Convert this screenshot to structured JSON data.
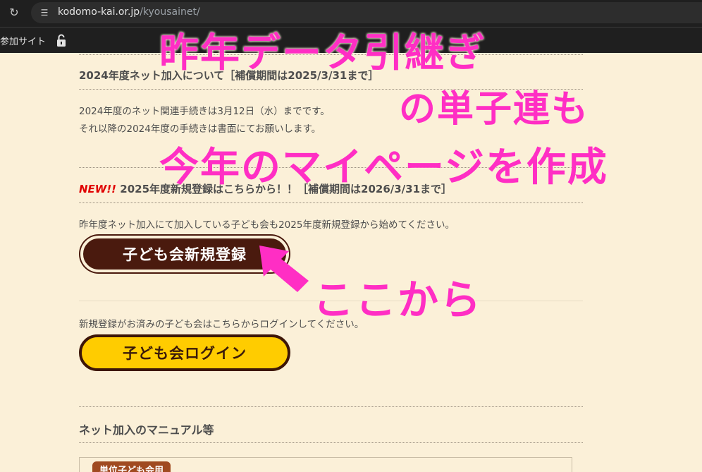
{
  "browser": {
    "url_host": "kodomo-kai.or.jp",
    "url_path": "/kyousainet/",
    "bookmark_label": "参加サイト"
  },
  "page": {
    "section1_heading": "2024年度ネット加入について［補償期間は2025/3/31まで］",
    "section1_line1": "2024年度のネット関連手続きは3月12日（水）までです。",
    "section1_line2": "それ以降の2024年度の手続きは書面にてお願いします。",
    "section2_new": "NEW!!",
    "section2_heading": " 2025年度新規登録はこちらから！！［補償期間は2026/3/31まで］",
    "section2_text": "昨年度ネット加入にて加入している子ども会も2025年度新規登録から始めてください。",
    "register_button": "子ども会新規登録",
    "login_text": "新規登録がお済みの子ども会はこちらからログインしてください。",
    "login_button": "子ども会ログイン",
    "manual_heading": "ネット加入のマニュアル等",
    "manual_tag": "単位子ども会用"
  },
  "annotations": {
    "line1": "昨年データ引継ぎ",
    "line2": "の単子連も",
    "line3": "今年のマイページを作成",
    "pointer": "ここから"
  },
  "colors": {
    "background": "#fbf0d8",
    "annotation_pink": "#ff2ec4",
    "register_button": "#4a1a0e",
    "login_button": "#ffcc00",
    "new_badge": "#e00000"
  }
}
